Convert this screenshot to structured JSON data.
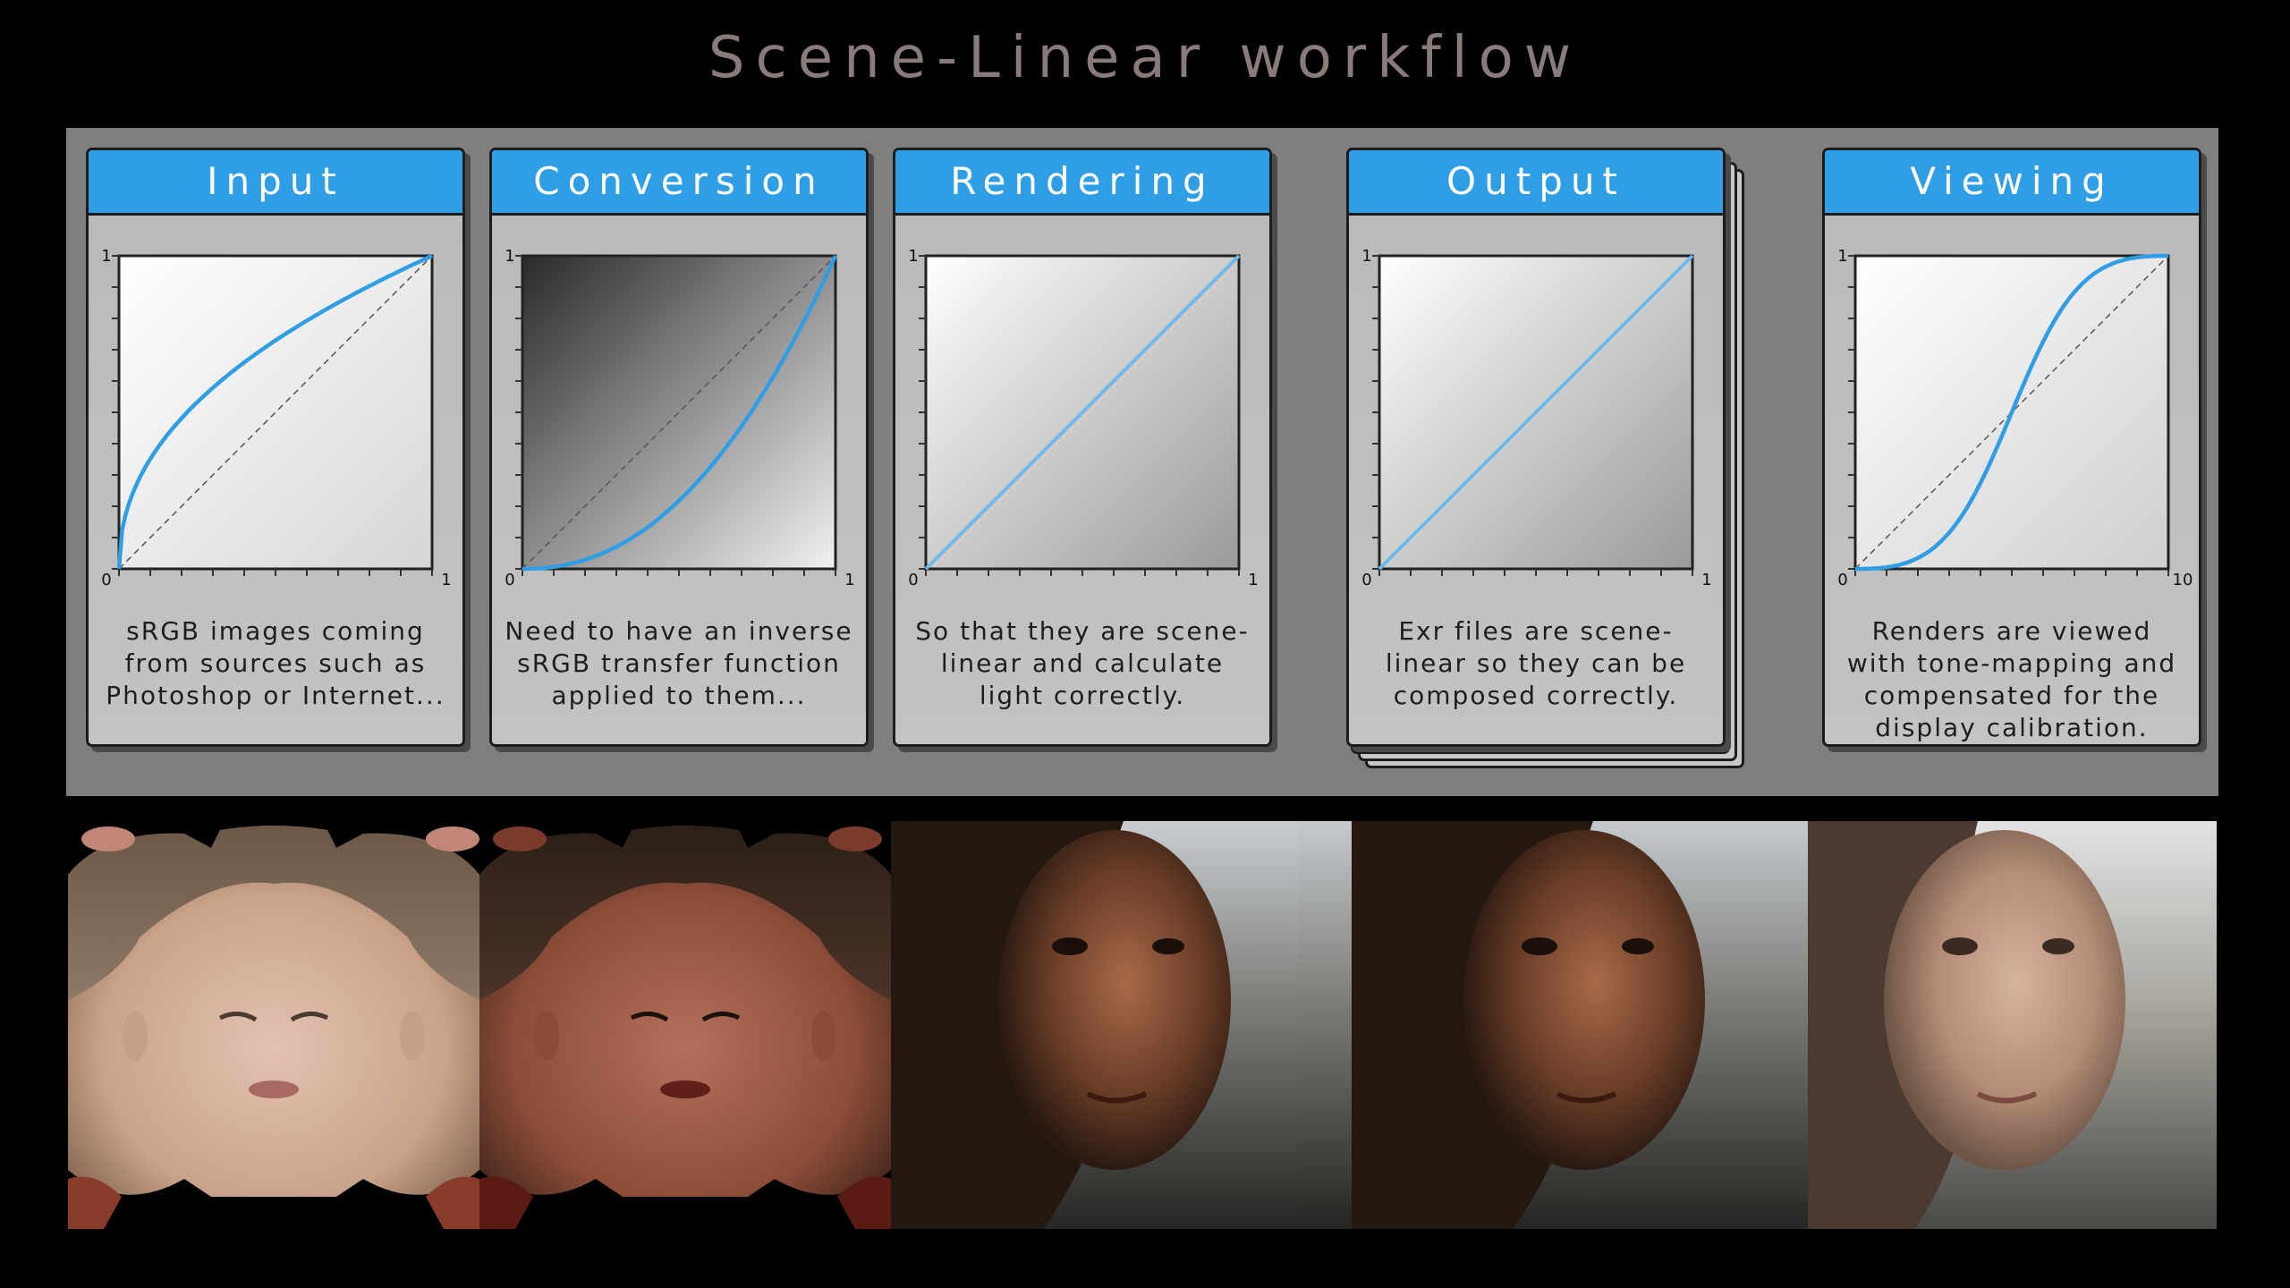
{
  "title": "Scene-Linear workflow",
  "stages": [
    {
      "label": "Input",
      "description": "sRGB images coming\nfrom sources such as\nPhotoshop or Internet...",
      "axis": {
        "x_min": "0",
        "x_max": "1",
        "y_max": "1"
      },
      "curve": "srgb-encode"
    },
    {
      "label": "Conversion",
      "description": "Need to have an inverse\nsRGB transfer function\napplied to them...",
      "axis": {
        "x_min": "0",
        "x_max": "1",
        "y_max": "1"
      },
      "curve": "srgb-decode"
    },
    {
      "label": "Rendering",
      "description": "So that they are scene-\nlinear and calculate\nlight correctly.",
      "axis": {
        "x_min": "0",
        "x_max": "1",
        "y_max": "1"
      },
      "curve": "linear"
    },
    {
      "label": "Output",
      "description": "Exr files are scene-\nlinear so they can be\ncomposed correctly.",
      "axis": {
        "x_min": "0",
        "x_max": "1",
        "y_max": "1"
      },
      "curve": "linear"
    },
    {
      "label": "Viewing",
      "description": "Renders are viewed\nwith tone-mapping and\ncompensated for the\ndisplay calibration.",
      "axis": {
        "x_min": "0",
        "x_max": "10",
        "y_max": "1"
      },
      "curve": "tone-map"
    }
  ],
  "images": [
    {
      "name": "texture-map-srgb"
    },
    {
      "name": "texture-map-linear"
    },
    {
      "name": "render-linear-1"
    },
    {
      "name": "render-linear-2"
    },
    {
      "name": "render-tonemapped"
    }
  ],
  "colors": {
    "accent": "#2f9ee4",
    "curve": "#2f9ee4",
    "panel": "#7f7f7f",
    "title": "#8a7b7b"
  }
}
